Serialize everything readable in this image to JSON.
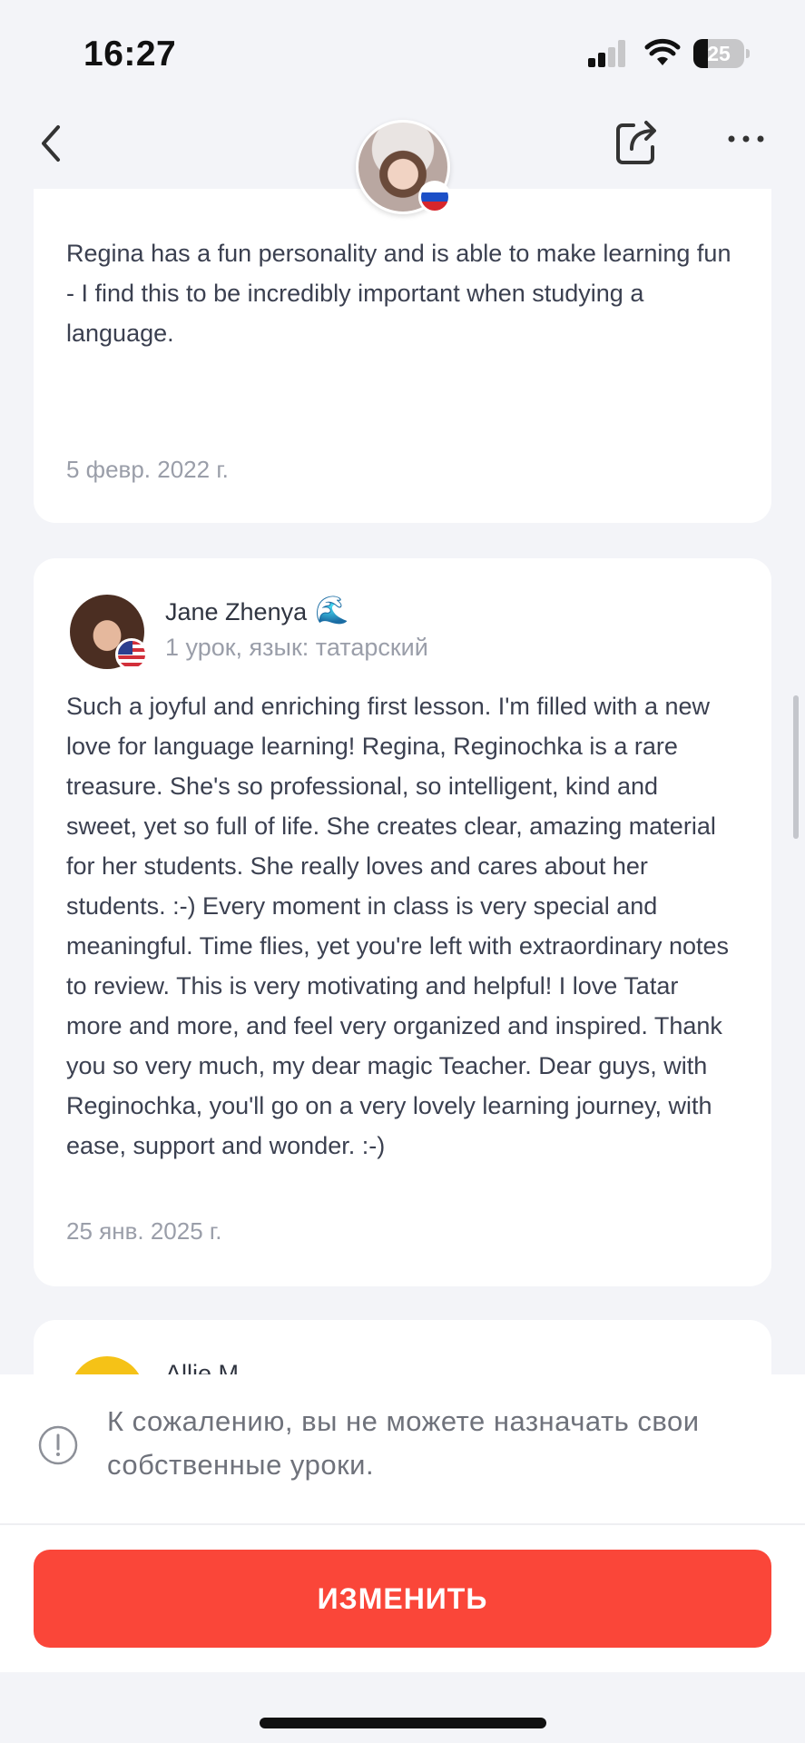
{
  "status_bar": {
    "time": "16:27",
    "battery": "25"
  },
  "header": {
    "back_icon": "chevron-left-icon",
    "share_icon": "share-icon",
    "more_icon": "more-horizontal-icon"
  },
  "reviews": [
    {
      "text": "understanding. She is professional and friendly, so no matter what you may struggle with, she is there to help clarify concepts about the Russian language.\n\nRegina has a fun personality and is able to make learning fun - I find this to be incredibly important when studying a language.",
      "date": "5 февр. 2022 г."
    },
    {
      "author": "Jane Zhenya",
      "author_emoji": "🌊",
      "meta": "1 урок, язык: татарский",
      "text": "Such a joyful and enriching first lesson. I'm filled with a new love for language learning! Regina, Reginochka is a rare treasure. She's so professional, so intelligent, kind and sweet, yet so full of life. She creates clear, amazing material for her students. She really loves and cares about her students. :-) Every moment in class is very special and meaningful. Time flies, yet you're left with extraordinary notes to review. This is very motivating and helpful! I love Tatar more and more, and feel very organized and inspired. Thank you so very much, my dear magic Teacher. Dear guys, with Reginochka, you'll go on a very lovely learning journey, with ease, support and wonder. :-)",
      "date": "25 янв. 2025 г."
    },
    {
      "author": "Allie M"
    }
  ],
  "notice": {
    "icon": "info-icon",
    "text": "К сожалению, вы не можете назначать свои собственные уроки."
  },
  "action": {
    "button_label": "ИЗМЕНИТЬ"
  },
  "colors": {
    "accent": "#fa4639",
    "background": "#f3f4f8",
    "card": "#ffffff"
  }
}
